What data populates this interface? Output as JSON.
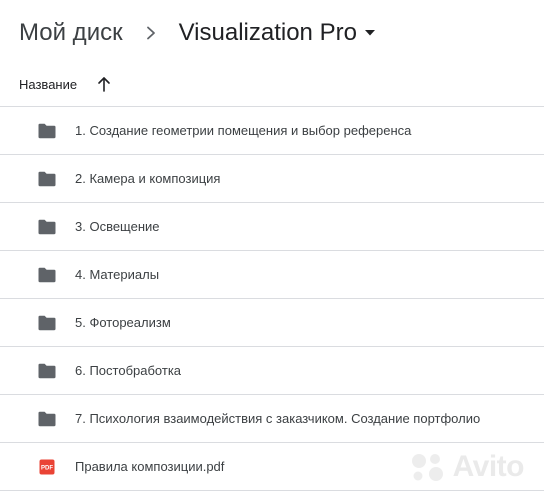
{
  "breadcrumb": {
    "root": "Мой диск",
    "current": "Visualization Pro"
  },
  "list_header": {
    "name_column": "Название",
    "sort": "ascending"
  },
  "files": [
    {
      "type": "folder",
      "name": "1. Создание геометрии помещения и выбор референса"
    },
    {
      "type": "folder",
      "name": "2. Камера и композиция"
    },
    {
      "type": "folder",
      "name": "3. Освещение"
    },
    {
      "type": "folder",
      "name": "4. Материалы"
    },
    {
      "type": "folder",
      "name": "5. Фотореализм"
    },
    {
      "type": "folder",
      "name": "6. Постобработка"
    },
    {
      "type": "folder",
      "name": "7. Психология взаимодействия с заказчиком. Создание портфолио"
    },
    {
      "type": "pdf",
      "name": "Правила композиции.pdf"
    }
  ],
  "icons": {
    "folder": "folder-icon",
    "pdf": "pdf-file-icon",
    "separator": "chevron-right-icon",
    "dropdown": "caret-down-icon",
    "sort": "arrow-up-icon"
  },
  "colors": {
    "folder": "#5f6368",
    "pdf": "#ea4335",
    "divider": "#dadce0"
  },
  "watermark": {
    "text": "Avito"
  }
}
